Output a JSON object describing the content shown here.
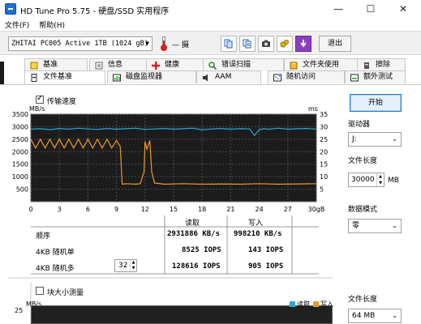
{
  "window": {
    "title": "HD Tune Pro 5.75 - 硬盘/SSD 实用程序",
    "minimize": "—",
    "maximize": "☐",
    "close": "✕"
  },
  "menu": {
    "items": [
      "文件(F)",
      "帮助(H)"
    ]
  },
  "toolbar": {
    "drive": "ZHITAI PC005 Active 1TB (1024 gB)",
    "temperature": "— 摄",
    "exit_label": "退出",
    "icons": [
      "copy-icon",
      "copy-info-icon",
      "camera-icon",
      "options-icon",
      "save-icon"
    ]
  },
  "tabs_row1": [
    {
      "label": "基准",
      "icon": "benchmark-icon"
    },
    {
      "label": "信息",
      "icon": "info-icon"
    },
    {
      "label": "健康",
      "icon": "health-icon"
    },
    {
      "label": "错误扫描",
      "icon": "error-scan-icon"
    },
    {
      "label": "文件夹使用",
      "icon": "folder-usage-icon"
    },
    {
      "label": "擦除",
      "icon": "erase-icon"
    }
  ],
  "tabs_row2": [
    {
      "label": "文件基准",
      "icon": "file-benchmark-icon",
      "active": true
    },
    {
      "label": "磁盘监视器",
      "icon": "disk-monitor-icon"
    },
    {
      "label": "AAM",
      "icon": "aam-icon"
    },
    {
      "label": "随机访问",
      "icon": "random-access-icon"
    },
    {
      "label": "额外测试",
      "icon": "extra-tests-icon"
    }
  ],
  "transfer": {
    "checkbox_label": "传输速度",
    "checked": true
  },
  "chart_data": {
    "type": "line",
    "title": "",
    "ylabel_left": "MB/s",
    "ylabel_right": "ms",
    "xlabel": "",
    "x_unit": "gB",
    "y_left_ticks": [
      "3500",
      "3000",
      "2500",
      "2000",
      "1500",
      "1000",
      "500"
    ],
    "y_right_ticks": [
      "35",
      "30",
      "25",
      "20",
      "15",
      "10",
      "5"
    ],
    "x_ticks": [
      "0",
      "3",
      "6",
      "9",
      "12",
      "15",
      "18",
      "21",
      "24",
      "27",
      "30gB"
    ],
    "ylim_left": [
      0,
      3500
    ],
    "ylim_right": [
      0,
      35
    ],
    "xlim": [
      0,
      30
    ],
    "grid": true,
    "series": [
      {
        "name": "读取",
        "color": "#2aa8d8",
        "x": [
          0,
          1,
          2,
          3,
          4,
          5,
          6,
          7,
          8,
          9,
          10,
          11,
          12,
          13,
          14,
          15,
          16,
          17,
          18,
          19,
          20,
          21,
          22,
          23,
          23.5,
          24,
          24.5,
          25,
          26,
          27,
          28,
          29,
          30
        ],
        "y": [
          2900,
          2920,
          2880,
          2930,
          2900,
          2940,
          2910,
          2890,
          2930,
          2900,
          2920,
          2940,
          2890,
          2910,
          2930,
          2900,
          2920,
          2940,
          2880,
          2910,
          2930,
          2900,
          2920,
          2910,
          2650,
          2880,
          2920,
          2900,
          2940,
          2900,
          2920,
          2930,
          2900
        ]
      },
      {
        "name": "写入",
        "color": "#e89a2c",
        "x": [
          0,
          0.5,
          1,
          1.5,
          2,
          2.5,
          3,
          3.5,
          4,
          4.5,
          5,
          5.5,
          6,
          6.5,
          7,
          7.5,
          8,
          8.5,
          9,
          9.4,
          9.6,
          10,
          11,
          11.5,
          11.9,
          12,
          12.2,
          12.5,
          12.7,
          13,
          14,
          16,
          18,
          20,
          22,
          24,
          26,
          28,
          30
        ],
        "y": [
          2500,
          2150,
          2500,
          2150,
          2500,
          2150,
          2500,
          2150,
          2500,
          2150,
          2500,
          2150,
          2500,
          2150,
          2500,
          2150,
          2500,
          2150,
          2450,
          2200,
          700,
          720,
          700,
          720,
          1200,
          2400,
          2100,
          2450,
          1200,
          750,
          700,
          720,
          700,
          710,
          700,
          720,
          700,
          710,
          720
        ]
      }
    ]
  },
  "results": {
    "col_read": "读取",
    "col_write": "写入",
    "rows": [
      {
        "label": "顺序",
        "read": "2931886 KB/s",
        "write": "998210 KB/s"
      },
      {
        "label": "4KB 随机单",
        "read": "8525 IOPS",
        "write": "143 IOPS"
      },
      {
        "label": "4KB 随机多",
        "read": "128616 IOPS",
        "write": "905 IOPS"
      }
    ],
    "queue_depth": "32"
  },
  "sidebar": {
    "start_label": "开始",
    "drive_label": "驱动器",
    "drive_value": "J:",
    "file_length_label": "文件长度",
    "file_length_value": "30000",
    "file_length_unit": "MB",
    "data_pattern_label": "数据模式",
    "data_pattern_value": "零",
    "file_length2_label": "文件长度",
    "file_length2_value": "64 MB"
  },
  "block": {
    "checkbox_label": "块大小测量",
    "checked": false,
    "ylabel": "MB/s",
    "y_top": "25",
    "legend_read": "读取",
    "legend_write": "写入"
  }
}
